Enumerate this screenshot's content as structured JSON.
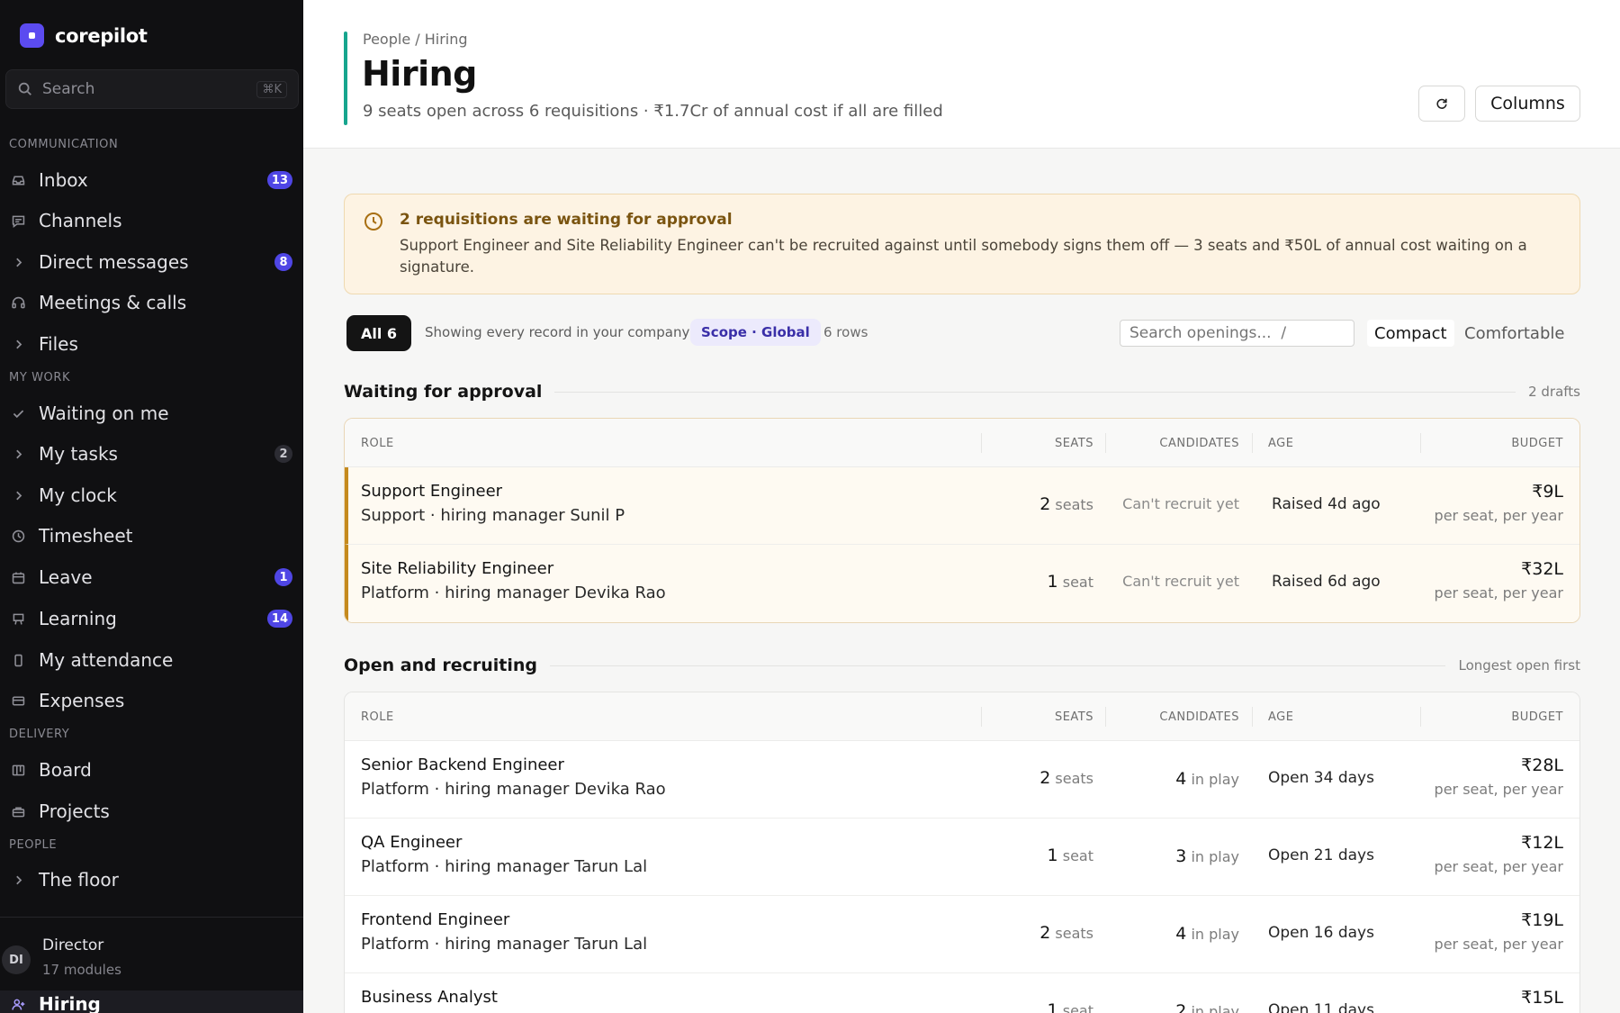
{
  "app": {
    "name": "corepilot",
    "accent": "#5b4bf0"
  },
  "sidebar": {
    "search": {
      "placeholder": "Search",
      "shortcut": "⌘K"
    },
    "sections": {
      "communication": "COMMUNICATION",
      "my_work": "MY WORK",
      "delivery": "DELIVERY",
      "people": "PEOPLE"
    },
    "items": {
      "inbox": {
        "label": "Inbox",
        "badge": "13",
        "icon": "inbox-icon"
      },
      "channels": {
        "label": "Channels",
        "icon": "chat-icon"
      },
      "direct_messages": {
        "label": "Direct messages",
        "badge": "8",
        "icon": "chevron-right-icon"
      },
      "meetings": {
        "label": "Meetings & calls",
        "icon": "headset-icon"
      },
      "files": {
        "label": "Files",
        "icon": "chevron-right-icon"
      },
      "waiting": {
        "label": "Waiting on me",
        "icon": "check-icon"
      },
      "tasks": {
        "label": "My tasks",
        "badge": "2",
        "icon": "chevron-right-icon"
      },
      "clock": {
        "label": "My clock",
        "icon": "chevron-right-icon"
      },
      "timesheet": {
        "label": "Timesheet",
        "icon": "clock-icon"
      },
      "leave": {
        "label": "Leave",
        "badge": "1",
        "icon": "calendar-icon"
      },
      "learning": {
        "label": "Learning",
        "badge": "14",
        "icon": "easel-icon"
      },
      "attendance": {
        "label": "My attendance",
        "icon": "phone-icon"
      },
      "expenses": {
        "label": "Expenses",
        "icon": "card-icon"
      },
      "board": {
        "label": "Board",
        "icon": "board-icon"
      },
      "projects": {
        "label": "Projects",
        "icon": "briefcase-icon"
      },
      "floor": {
        "label": "The floor",
        "icon": "chevron-right-icon"
      },
      "hiring": {
        "label": "Hiring",
        "icon": "user-plus-icon"
      }
    },
    "user": {
      "initials": "DI",
      "name": "Director",
      "sub": "17 modules"
    }
  },
  "header": {
    "breadcrumb": "People / Hiring",
    "title": "Hiring",
    "subtitle": "9 seats open across 6 requisitions · ₹1.7Cr of annual cost if all are filled",
    "columns_label": "Columns"
  },
  "alert": {
    "title": "2 requisitions are waiting for approval",
    "body": "Support Engineer and Site Reliability Engineer can't be recruited against until somebody signs them off — 3 seats and ₹50L of annual cost waiting on a signature."
  },
  "toolbar": {
    "all_label": "All 6",
    "showing": "Showing every record in your company",
    "scope": "Scope · Global",
    "rows": "6 rows",
    "search_placeholder": "Search openings...  /",
    "compact": "Compact",
    "comfortable": "Comfortable"
  },
  "columns": {
    "role": "ROLE",
    "seats": "SEATS",
    "candidates": "CANDIDATES",
    "age": "AGE",
    "budget": "BUDGET"
  },
  "pending": {
    "heading": "Waiting for approval",
    "meta": "2 drafts",
    "rows": [
      {
        "title": "Support Engineer",
        "sub": "Support · hiring manager Sunil P",
        "seats": "2",
        "seats_unit": "seats",
        "candidates": "Can't recruit yet",
        "age": "Raised 4d ago",
        "budget": "₹9L",
        "budget_note": "per seat, per year"
      },
      {
        "title": "Site Reliability Engineer",
        "sub": "Platform · hiring manager Devika Rao",
        "seats": "1",
        "seats_unit": "seat",
        "candidates": "Can't recruit yet",
        "age": "Raised 6d ago",
        "budget": "₹32L",
        "budget_note": "per seat, per year"
      }
    ]
  },
  "open": {
    "heading": "Open and recruiting",
    "meta": "Longest open first",
    "rows": [
      {
        "title": "Senior Backend Engineer",
        "sub": "Platform · hiring manager Devika Rao",
        "seats": "2",
        "seats_unit": "seats",
        "candidates": "4",
        "candidates_unit": "in play",
        "age": "Open 34 days",
        "budget": "₹28L",
        "budget_note": "per seat, per year"
      },
      {
        "title": "QA Engineer",
        "sub": "Platform · hiring manager Tarun Lal",
        "seats": "1",
        "seats_unit": "seat",
        "candidates": "3",
        "candidates_unit": "in play",
        "age": "Open 21 days",
        "budget": "₹12L",
        "budget_note": "per seat, per year"
      },
      {
        "title": "Frontend Engineer",
        "sub": "Platform · hiring manager Tarun Lal",
        "seats": "2",
        "seats_unit": "seats",
        "candidates": "4",
        "candidates_unit": "in play",
        "age": "Open 16 days",
        "budget": "₹19L",
        "budget_note": "per seat, per year"
      },
      {
        "title": "Business Analyst",
        "sub": "",
        "seats": "1",
        "seats_unit": "seat",
        "candidates": "2",
        "candidates_unit": "in play",
        "age": "Open 11 days",
        "budget": "₹15L",
        "budget_note": ""
      }
    ]
  }
}
